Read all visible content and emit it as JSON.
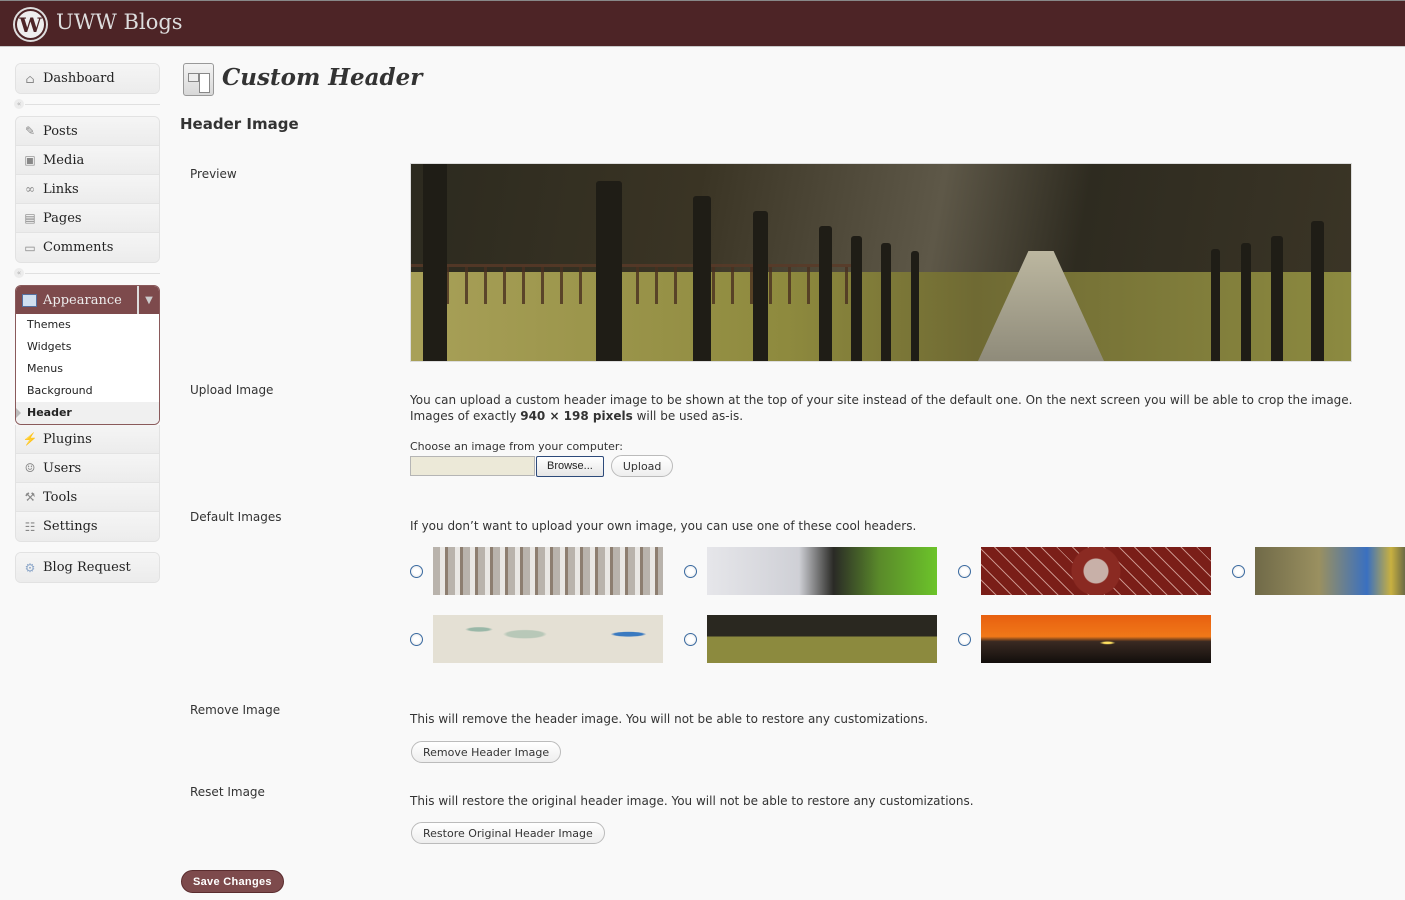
{
  "topbar": {
    "site_title": "UWW Blogs",
    "logo": "wordpress-logo-icon"
  },
  "sidebar": {
    "dashboard": {
      "label": "Dashboard",
      "icon": "home-icon"
    },
    "content_items": [
      {
        "label": "Posts",
        "icon": "pushpin-icon"
      },
      {
        "label": "Media",
        "icon": "media-icon"
      },
      {
        "label": "Links",
        "icon": "link-icon"
      },
      {
        "label": "Pages",
        "icon": "pages-icon"
      },
      {
        "label": "Comments",
        "icon": "comment-icon"
      }
    ],
    "appearance": {
      "label": "Appearance",
      "icon": "appearance-icon",
      "submenu": [
        "Themes",
        "Widgets",
        "Menus",
        "Background",
        "Header"
      ],
      "current": "Header"
    },
    "admin_items": [
      {
        "label": "Plugins",
        "icon": "plug-icon"
      },
      {
        "label": "Users",
        "icon": "users-icon"
      },
      {
        "label": "Tools",
        "icon": "tools-icon"
      },
      {
        "label": "Settings",
        "icon": "settings-icon"
      }
    ],
    "extra_items": [
      {
        "label": "Blog Request",
        "icon": "gear-icon"
      }
    ],
    "collapse_glyph": "«"
  },
  "main": {
    "page_title": "Custom Header",
    "section_title": "Header Image",
    "preview": {
      "label": "Preview"
    },
    "upload": {
      "label": "Upload Image",
      "desc_line1": "You can upload a custom header image to be shown at the top of your site instead of the default one. On the next screen you will be able to crop the image.",
      "desc_prefix": "Images of exactly ",
      "desc_bold": "940 × 198 pixels",
      "desc_suffix": " will be used as-is.",
      "choose_label": "Choose an image from your computer:",
      "browse_label": "Browse...",
      "upload_label": "Upload"
    },
    "defaults": {
      "label": "Default Images",
      "desc": "If you don’t want to upload your own image, you can use one of these cool headers.",
      "images": [
        {
          "name": "snowy-forest",
          "selected": false
        },
        {
          "name": "cherry-blossom",
          "selected": false
        },
        {
          "name": "red-pattern",
          "selected": false
        },
        {
          "name": "leaves",
          "selected": false
        },
        {
          "name": "watercolor-wordpress",
          "selected": false
        },
        {
          "name": "tree-path",
          "selected": false
        },
        {
          "name": "sunset",
          "selected": false
        }
      ]
    },
    "remove": {
      "label": "Remove Image",
      "desc": "This will remove the header image. You will not be able to restore any customizations.",
      "button": "Remove Header Image"
    },
    "reset": {
      "label": "Reset Image",
      "desc": "This will restore the original header image. You will not be able to restore any customizations.",
      "button": "Restore Original Header Image"
    },
    "save_label": "Save Changes"
  },
  "colors": {
    "brand": "#4d2426",
    "accent": "#7d4a4c"
  }
}
